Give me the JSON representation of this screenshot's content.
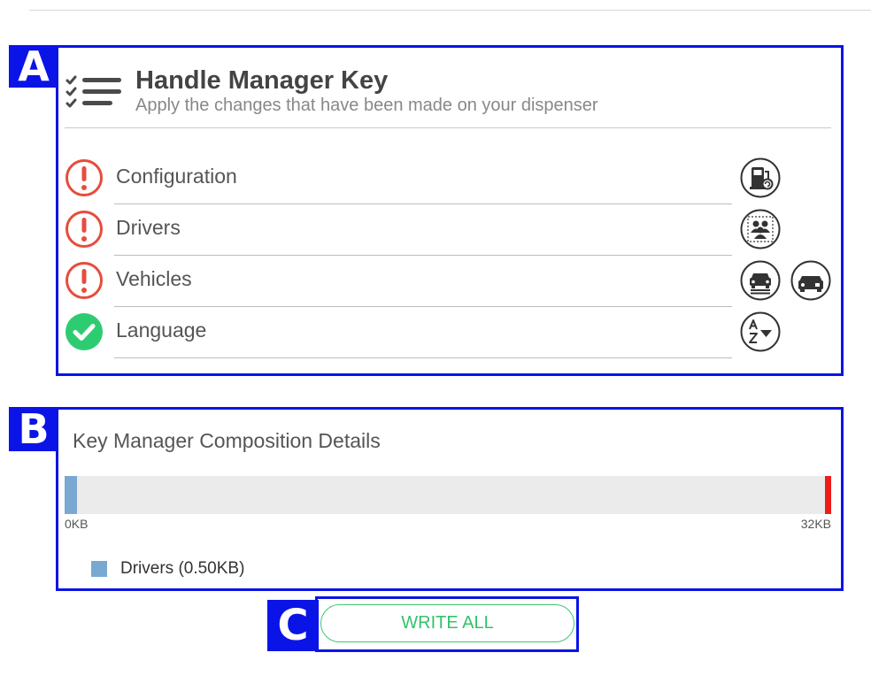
{
  "header": {
    "title": "Handle Manager Key",
    "subtitle": "Apply the changes that have been made on your dispenser"
  },
  "callouts": {
    "a": "A",
    "b": "B",
    "c": "C"
  },
  "items": [
    {
      "label": "Configuration",
      "status": "warning",
      "actions": [
        "dispenser-config-icon"
      ]
    },
    {
      "label": "Drivers",
      "status": "warning",
      "actions": [
        "drivers-group-icon"
      ]
    },
    {
      "label": "Vehicles",
      "status": "warning",
      "actions": [
        "vehicles-list-icon",
        "vehicle-icon"
      ]
    },
    {
      "label": "Language",
      "status": "ok",
      "actions": [
        "language-sort-icon"
      ]
    }
  ],
  "composition": {
    "title": "Key Manager Composition Details",
    "min_label": "0KB",
    "max_label": "32KB",
    "used_kb": 0.5,
    "capacity_kb": 32,
    "legend": [
      {
        "label": "Drivers (0.50KB)",
        "color": "#79a8d2"
      }
    ]
  },
  "actions": {
    "write_all_label": "WRITE ALL"
  },
  "colors": {
    "callout": "#0a14e6",
    "warning": "#e74c3c",
    "ok": "#2ecc71",
    "limit": "#ef1c1c",
    "button_green": "#34c26a"
  }
}
